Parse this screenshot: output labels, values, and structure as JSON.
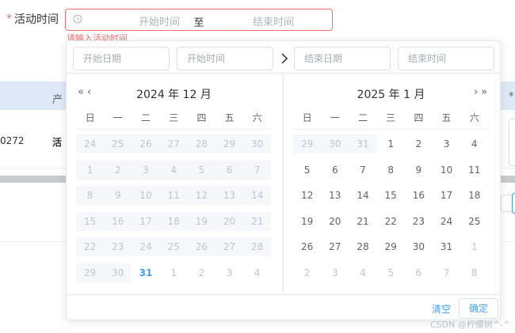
{
  "form": {
    "required_mark": "*",
    "label": "活动时间",
    "start_placeholder": "开始时间",
    "separator": "至",
    "end_placeholder": "结束时间",
    "error": "请输入活动时间"
  },
  "table": {
    "header_text": "产",
    "header_star": "*",
    "row_id": "0272",
    "row_name": "活"
  },
  "picker": {
    "start_date_placeholder": "开始日期",
    "start_time_placeholder": "开始时间",
    "end_date_placeholder": "结束日期",
    "end_time_placeholder": "结束时间",
    "weekdays": [
      "日",
      "一",
      "二",
      "三",
      "四",
      "五",
      "六"
    ],
    "left": {
      "title": "2024 年 12 月",
      "prev_year": "«",
      "prev_month": "‹",
      "weeks": [
        [
          "24",
          "25",
          "26",
          "27",
          "28",
          "29",
          "30"
        ],
        [
          "1",
          "2",
          "3",
          "4",
          "5",
          "6",
          "7"
        ],
        [
          "8",
          "9",
          "10",
          "11",
          "12",
          "13",
          "14"
        ],
        [
          "15",
          "16",
          "17",
          "18",
          "19",
          "20",
          "21"
        ],
        [
          "22",
          "23",
          "24",
          "25",
          "26",
          "27",
          "28"
        ],
        [
          "29",
          "30",
          "31",
          "1",
          "2",
          "3",
          "4"
        ]
      ]
    },
    "right": {
      "title": "2025 年 1 月",
      "next_month": "›",
      "next_year": "»",
      "weeks": [
        [
          "29",
          "30",
          "31",
          "1",
          "2",
          "3",
          "4"
        ],
        [
          "5",
          "6",
          "7",
          "8",
          "9",
          "10",
          "11"
        ],
        [
          "12",
          "13",
          "14",
          "15",
          "16",
          "17",
          "18"
        ],
        [
          "19",
          "20",
          "21",
          "22",
          "23",
          "24",
          "25"
        ],
        [
          "26",
          "27",
          "28",
          "29",
          "30",
          "31",
          "1"
        ],
        [
          "2",
          "3",
          "4",
          "5",
          "6",
          "7",
          "8"
        ]
      ]
    },
    "clear_label": "清空",
    "confirm_label": "确定"
  },
  "watermark": "CSDN @柠檬树^-^",
  "colors": {
    "accent": "#409eff",
    "error": "#f56c6c",
    "disabled_bg": "#f5f7fa",
    "table_header_bg": "#dde9f6"
  }
}
